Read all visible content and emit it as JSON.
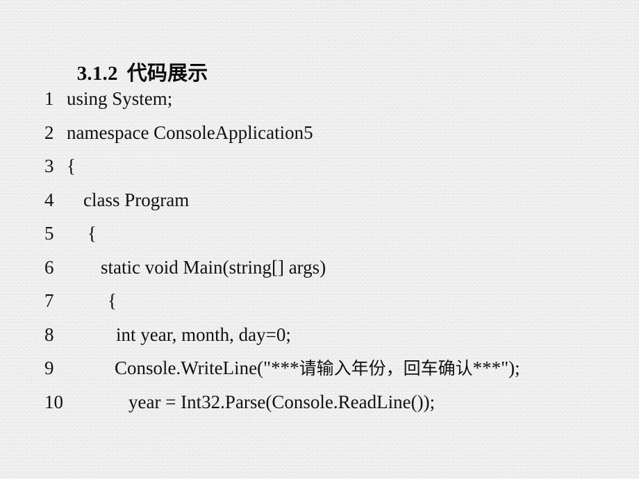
{
  "slide": {
    "background_color": "#ededeb",
    "text_color": "#111111",
    "title": {
      "number": "3.1.2",
      "cjk": "代码展示",
      "full": "3.1.2  代码展示"
    }
  },
  "code": {
    "language": "C#",
    "lines": [
      {
        "number": "1",
        "indent": "ind-0",
        "text": "using System;"
      },
      {
        "number": "2",
        "indent": "ind-0",
        "text": "namespace ConsoleApplication5"
      },
      {
        "number": "3",
        "indent": "ind-0",
        "text": "{"
      },
      {
        "number": "4",
        "indent": "ind-1",
        "text": "class Program"
      },
      {
        "number": "5",
        "indent": "ind-1b",
        "text": "{"
      },
      {
        "number": "6",
        "indent": "ind-2",
        "text": "static void Main(string[] args)"
      },
      {
        "number": "7",
        "indent": "ind-2b",
        "text": "{"
      },
      {
        "number": "8",
        "indent": "ind-3",
        "text": "int year, month, day=0;"
      },
      {
        "number": "9",
        "indent": "ind-3b",
        "text": "Console.WriteLine(\"***请输入年份，回车确认***\");"
      },
      {
        "number": "10",
        "indent": "ind-4",
        "text": "year = Int32.Parse(Console.ReadLine());"
      }
    ]
  }
}
